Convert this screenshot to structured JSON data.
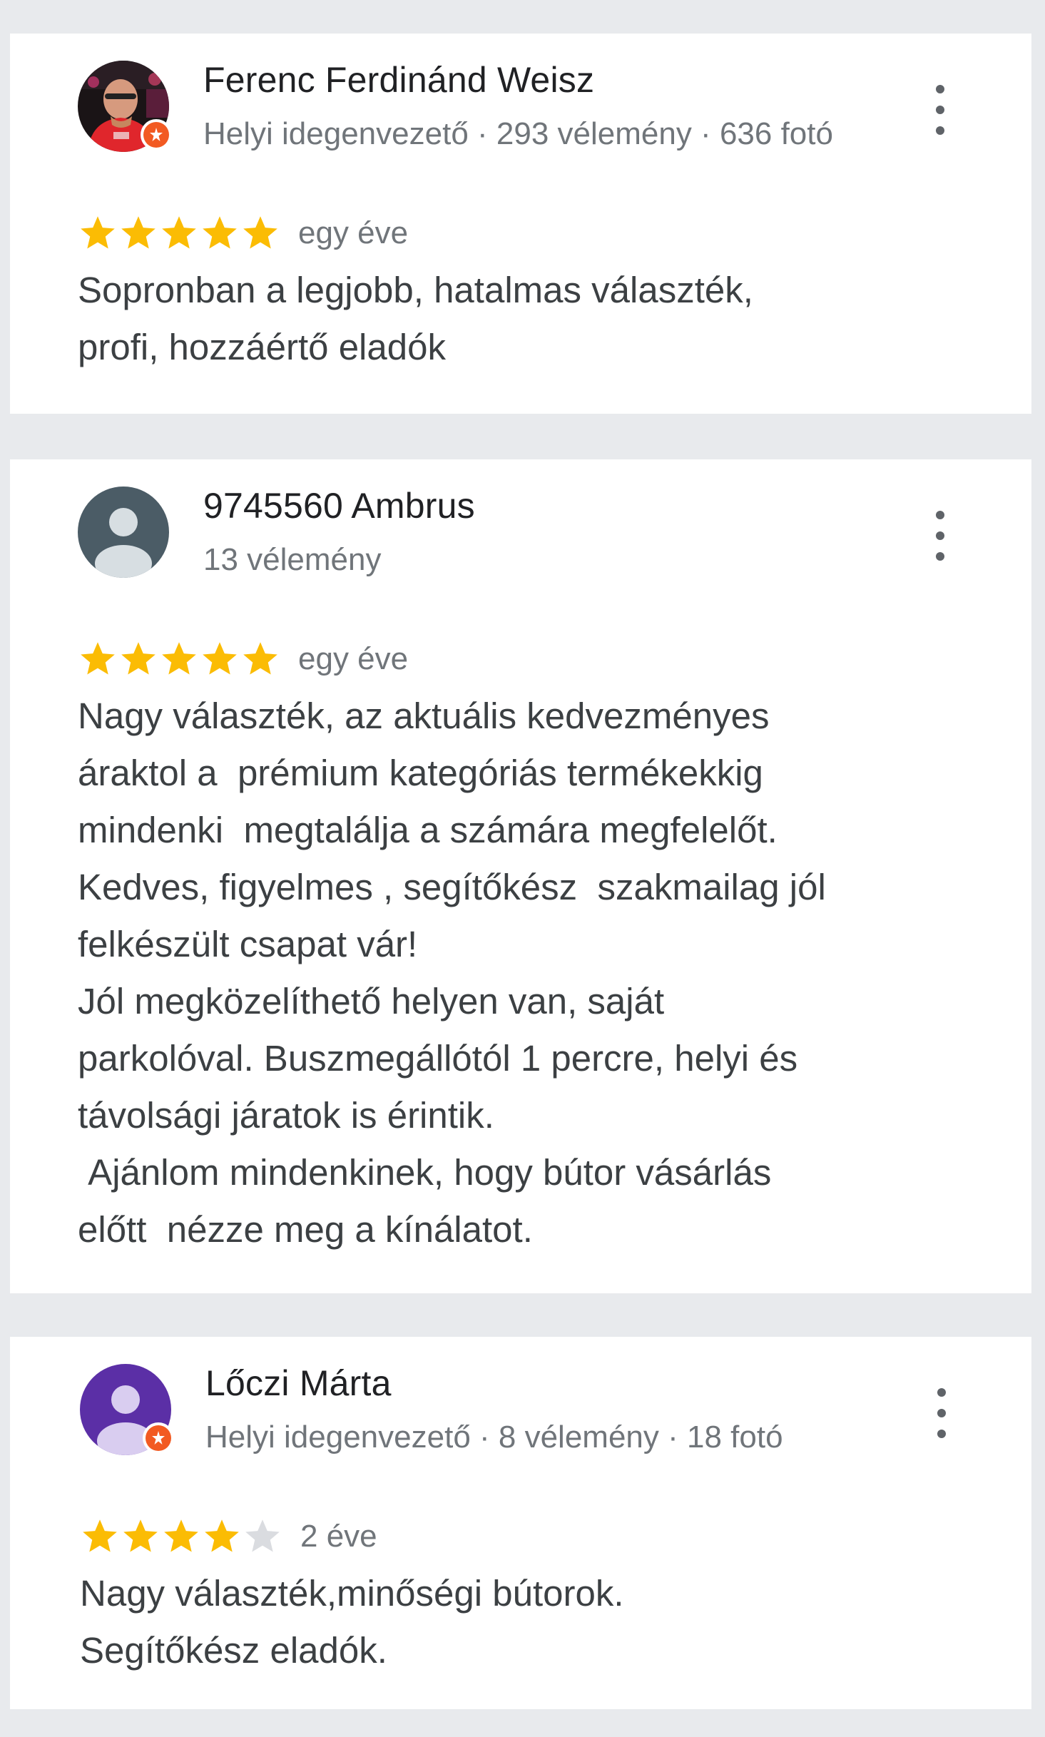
{
  "reviews": [
    {
      "author": "Ferenc Ferdinánd Weisz",
      "meta": "Helyi idegenvezető · 293 vélemény · 636 fotó",
      "rating": 5,
      "time": "egy éve",
      "text": "Sopronban a legjobb, hatalmas választék,\nprofi, hozzáértő eladók",
      "avatar": "photo-avatar",
      "local_guide": true
    },
    {
      "author": "9745560 Ambrus",
      "meta": "13 vélemény",
      "rating": 5,
      "time": "egy éve",
      "text": "Nagy választék, az aktuális kedvezményes\náraktol a  prémium kategóriás termékekkig\nmindenki  megtalálja a számára megfelelőt.\nKedves, figyelmes , segítőkész  szakmailag jól\nfelkészült csapat vár!\nJól megközelíthető helyen van, saját\nparkolóval. Buszmegállótól 1 percre, helyi és\ntávolsági járatok is érintik.\n Ajánlom mindenkinek, hogy bútor vásárlás\nelőtt  nézze meg a kínálatot.",
      "avatar": "default-person-avatar",
      "avatar_color": "#4b5c66",
      "local_guide": false
    },
    {
      "author": "Lőczi Márta",
      "meta": "Helyi idegenvezető · 8 vélemény · 18 fotó",
      "rating": 4,
      "time": "2 éve",
      "text": "Nagy választék,minőségi bútorok.\nSegítőkész eladók.",
      "avatar": "default-person-avatar",
      "avatar_color": "#5b2fa6",
      "local_guide": true
    }
  ],
  "colors": {
    "star_filled": "#fbbc04",
    "star_empty": "#dadce0",
    "local_guide_badge": "#f25a22",
    "background": "#e8eaed"
  }
}
